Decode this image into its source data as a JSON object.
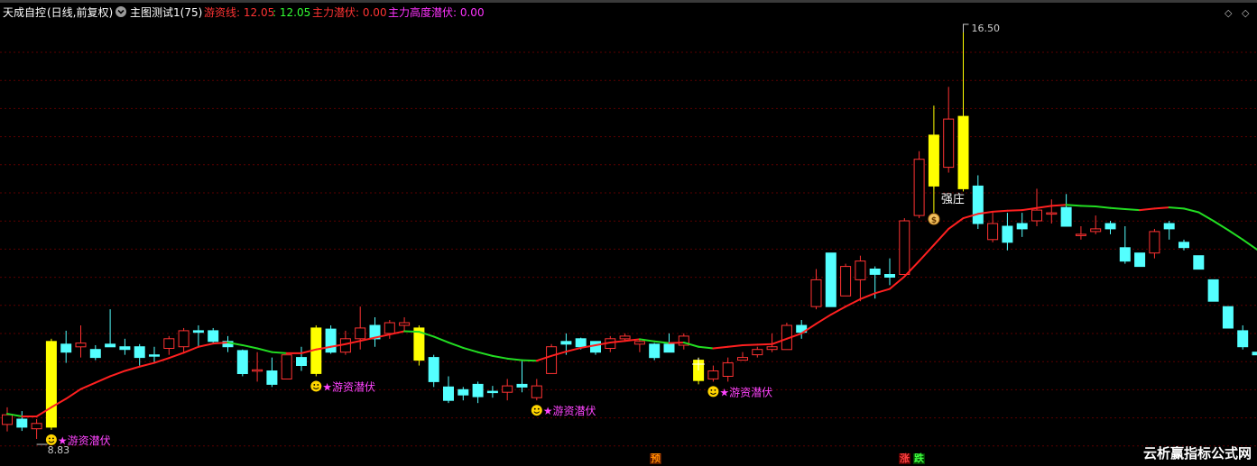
{
  "header": {
    "stock_name": "天成自控",
    "period": "(日线,前复权)",
    "menu_icon": "chevron-down-circle-icon",
    "formula": "主图测试1(75)",
    "ind1_label": "游资线: 12.05",
    "ind1_value2": ": 12.05",
    "ind2": "主力潜伏: 0.00",
    "ind3": "主力高度潜伏: 0.00",
    "colors": {
      "label": "#ffffff",
      "ind1": "#ff3333",
      "ind1b": "#33ff33",
      "ind2": "#ff3333",
      "ind3": "#ff33ff"
    }
  },
  "top_right": {
    "icon1": "diamond-icon",
    "icon2": "settings-icon"
  },
  "annotations": {
    "high_label": "16.50",
    "low_label": "8.83",
    "strong_label": "强庄",
    "series_label": "★游资线",
    "signal_label": "★游资潜伏"
  },
  "bottom_marks": {
    "yu": "预",
    "zhang": "涨",
    "die": "跌"
  },
  "watermark": "云析赢指标公式网",
  "colors": {
    "up": "#ff3232",
    "down": "#54ffff",
    "gold": "#ffff00",
    "ma_up": "#ff2020",
    "ma_down": "#22dd22",
    "signal_text": "#ff44ff",
    "grid": "#5a0000"
  },
  "chart_data": {
    "type": "candlestick",
    "price_range": [
      8.83,
      16.5
    ],
    "candles": [
      [
        9.1,
        9.28,
        9.42,
        8.97
      ],
      [
        9.2,
        9.05,
        9.35,
        8.98
      ],
      [
        9.02,
        9.12,
        9.2,
        8.83
      ],
      [
        9.05,
        10.65,
        10.7,
        9.0
      ],
      [
        10.6,
        10.45,
        10.85,
        10.25
      ],
      [
        10.55,
        10.62,
        10.95,
        10.35
      ],
      [
        10.5,
        10.35,
        10.58,
        10.3
      ],
      [
        10.6,
        10.55,
        11.25,
        10.55
      ],
      [
        10.55,
        10.5,
        10.7,
        10.4
      ],
      [
        10.55,
        10.35,
        10.6,
        10.2
      ],
      [
        10.4,
        10.38,
        10.55,
        10.25
      ],
      [
        10.52,
        10.7,
        10.75,
        10.4
      ],
      [
        10.55,
        10.85,
        10.9,
        10.45
      ],
      [
        10.85,
        10.82,
        10.95,
        10.55
      ],
      [
        10.85,
        10.65,
        10.9,
        10.6
      ],
      [
        10.65,
        10.55,
        10.75,
        10.45
      ],
      [
        10.48,
        10.05,
        10.5,
        10.0
      ],
      [
        10.1,
        10.12,
        10.45,
        9.9
      ],
      [
        10.1,
        9.85,
        10.35,
        9.8
      ],
      [
        9.95,
        10.4,
        10.4,
        9.95
      ],
      [
        10.35,
        10.2,
        10.55,
        10.1
      ],
      [
        10.05,
        10.9,
        10.95,
        10.0
      ],
      [
        10.88,
        10.45,
        10.95,
        10.42
      ],
      [
        10.45,
        10.7,
        10.85,
        10.4
      ],
      [
        10.7,
        10.9,
        11.3,
        10.5
      ],
      [
        10.95,
        10.7,
        11.1,
        10.55
      ],
      [
        10.8,
        11.0,
        11.05,
        10.7
      ],
      [
        10.95,
        11.0,
        11.1,
        10.85
      ],
      [
        10.9,
        10.3,
        10.95,
        10.2
      ],
      [
        10.35,
        9.9,
        10.4,
        9.8
      ],
      [
        9.8,
        9.55,
        10.0,
        9.5
      ],
      [
        9.75,
        9.65,
        9.8,
        9.55
      ],
      [
        9.85,
        9.62,
        9.9,
        9.5
      ],
      [
        9.72,
        9.7,
        9.82,
        9.6
      ],
      [
        9.7,
        9.82,
        9.95,
        9.55
      ],
      [
        9.85,
        9.8,
        10.3,
        9.7
      ],
      [
        9.6,
        9.82,
        9.95,
        9.55
      ],
      [
        10.05,
        10.55,
        10.6,
        10.05
      ],
      [
        10.65,
        10.6,
        10.8,
        10.4
      ],
      [
        10.7,
        10.55,
        10.72,
        10.5
      ],
      [
        10.65,
        10.45,
        10.65,
        10.4
      ],
      [
        10.52,
        10.7,
        10.75,
        10.45
      ],
      [
        10.7,
        10.75,
        10.8,
        10.65
      ],
      [
        10.6,
        10.65,
        10.7,
        10.45
      ],
      [
        10.6,
        10.35,
        10.62,
        10.3
      ],
      [
        10.6,
        10.45,
        10.8,
        10.45
      ],
      [
        10.58,
        10.75,
        10.8,
        10.5
      ],
      [
        10.3,
        9.92,
        10.35,
        9.85
      ],
      [
        9.95,
        10.1,
        10.2,
        9.9
      ],
      [
        10.0,
        10.25,
        10.35,
        9.9
      ],
      [
        10.3,
        10.35,
        10.45,
        10.3
      ],
      [
        10.4,
        10.5,
        10.55,
        10.35
      ],
      [
        10.5,
        10.55,
        10.8,
        10.45
      ],
      [
        10.5,
        10.95,
        11.0,
        10.5
      ],
      [
        10.95,
        10.82,
        11.05,
        10.7
      ],
      [
        11.3,
        11.8,
        12.0,
        11.25
      ],
      [
        12.3,
        11.3,
        12.3,
        11.3
      ],
      [
        11.5,
        12.05,
        12.1,
        11.5
      ],
      [
        11.8,
        12.15,
        12.25,
        11.4
      ],
      [
        12.0,
        11.9,
        12.05,
        11.45
      ],
      [
        11.9,
        11.85,
        12.2,
        11.7
      ],
      [
        11.9,
        12.9,
        12.95,
        11.9
      ],
      [
        13.0,
        14.05,
        14.2,
        12.95
      ],
      [
        14.5,
        13.55,
        15.05,
        13.5
      ],
      [
        13.9,
        14.8,
        15.4,
        13.8
      ],
      [
        14.85,
        13.5,
        16.5,
        13.45
      ],
      [
        13.55,
        12.85,
        13.75,
        12.75
      ],
      [
        12.55,
        12.85,
        13.05,
        12.5
      ],
      [
        12.8,
        12.5,
        13.05,
        12.35
      ],
      [
        12.85,
        12.75,
        13.05,
        12.6
      ],
      [
        12.9,
        13.1,
        13.5,
        12.8
      ],
      [
        13.05,
        13.05,
        13.3,
        12.85
      ],
      [
        13.15,
        12.8,
        13.4,
        12.8
      ],
      [
        12.65,
        12.65,
        12.8,
        12.55
      ],
      [
        12.7,
        12.75,
        13.0,
        12.65
      ],
      [
        12.85,
        12.75,
        12.9,
        12.65
      ],
      [
        12.4,
        12.15,
        12.8,
        12.1
      ],
      [
        12.3,
        12.05,
        12.3,
        12.05
      ],
      [
        12.3,
        12.7,
        12.75,
        12.2
      ],
      [
        12.85,
        12.75,
        12.9,
        12.55
      ],
      [
        12.5,
        12.4,
        12.55,
        12.35
      ],
      [
        12.25,
        12.0,
        12.25,
        12.0
      ],
      [
        11.8,
        11.4,
        11.8,
        11.4
      ],
      [
        11.3,
        10.9,
        11.3,
        10.9
      ],
      [
        10.85,
        10.55,
        10.95,
        10.5
      ],
      [
        10.45,
        10.4,
        10.6,
        10.3
      ],
      [
        10.25,
        10.15,
        10.25,
        10.05
      ]
    ],
    "ma_series": [
      9.3,
      9.25,
      9.25,
      9.42,
      9.58,
      9.76,
      9.88,
      10.0,
      10.1,
      10.18,
      10.25,
      10.34,
      10.44,
      10.55,
      10.61,
      10.63,
      10.58,
      10.52,
      10.45,
      10.43,
      10.43,
      10.5,
      10.55,
      10.6,
      10.66,
      10.72,
      10.78,
      10.84,
      10.83,
      10.74,
      10.63,
      10.53,
      10.45,
      10.38,
      10.33,
      10.3,
      10.29,
      10.38,
      10.46,
      10.53,
      10.58,
      10.63,
      10.66,
      10.69,
      10.65,
      10.62,
      10.63,
      10.55,
      10.52,
      10.55,
      10.58,
      10.59,
      10.6,
      10.7,
      10.8,
      10.98,
      11.15,
      11.3,
      11.44,
      11.55,
      11.63,
      11.86,
      12.15,
      12.45,
      12.75,
      12.95,
      13.03,
      13.07,
      13.09,
      13.1,
      13.14,
      13.18,
      13.2,
      13.18,
      13.17,
      13.14,
      13.12,
      13.1,
      13.13,
      13.15,
      13.13,
      13.06,
      12.9,
      12.73,
      12.55,
      12.36,
      12.2
    ]
  }
}
